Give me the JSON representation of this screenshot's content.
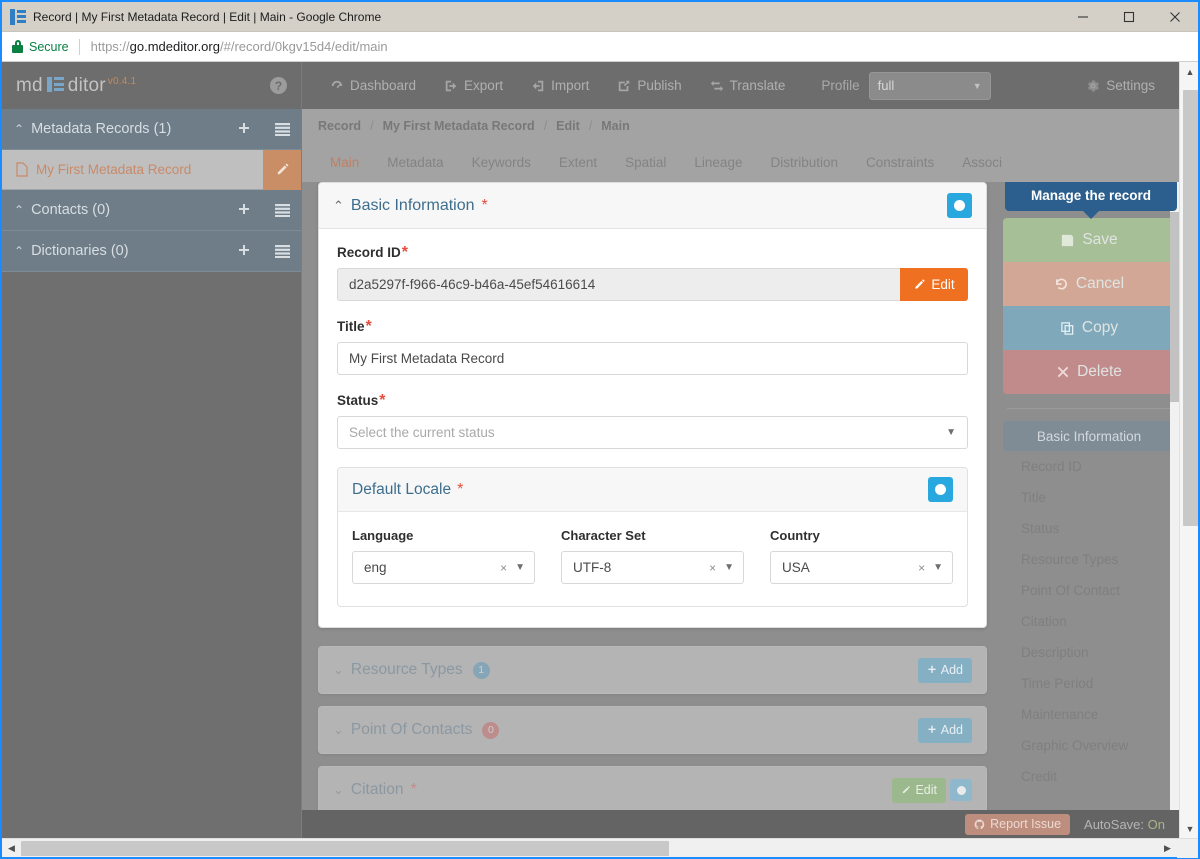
{
  "window": {
    "title": "Record | My First Metadata Record | Edit | Main - Google Chrome",
    "minimize": "—",
    "maximize": "□",
    "close": "✕"
  },
  "address_bar": {
    "security_label": "Secure",
    "url_prefix": "https://",
    "url_domain": "go.mdeditor.org",
    "url_path": "/#/record/0kgv15d4/edit/main",
    "lock_icon": "lock-icon"
  },
  "app_header": {
    "brand_pre": "md",
    "brand_post": "ditor",
    "version": "v0.4.1",
    "help_icon": "question-mark-icon",
    "menu_items": [
      {
        "label": "Dashboard",
        "icon": "dashboard-icon"
      },
      {
        "label": "Export",
        "icon": "export-icon"
      },
      {
        "label": "Import",
        "icon": "import-icon"
      },
      {
        "label": "Publish",
        "icon": "publish-icon"
      },
      {
        "label": "Translate",
        "icon": "translate-icon"
      }
    ],
    "profile_label": "Profile",
    "profile_value": "full",
    "settings_label": "Settings",
    "settings_icon": "gear-icon"
  },
  "sidebar": {
    "groups": [
      {
        "title": "Metadata Records (1)",
        "add_icon": "plus-icon",
        "list_icon": "list-icon"
      },
      {
        "title": "Contacts (0)",
        "add_icon": "plus-icon",
        "list_icon": "list-icon"
      },
      {
        "title": "Dictionaries (0)",
        "add_icon": "plus-icon",
        "list_icon": "list-icon"
      }
    ],
    "record_item": {
      "label": "My First Metadata Record",
      "file_icon": "file-icon",
      "edit_icon": "pencil-icon"
    }
  },
  "breadcrumb": {
    "items": [
      "Record",
      "My First Metadata Record",
      "Edit",
      "Main"
    ],
    "separator": "/"
  },
  "tabs": [
    {
      "label": "Main",
      "active": true
    },
    {
      "label": "Metadata",
      "active": false
    },
    {
      "label": "Keywords",
      "active": false
    },
    {
      "label": "Extent",
      "active": false
    },
    {
      "label": "Spatial",
      "active": false
    },
    {
      "label": "Lineage",
      "active": false
    },
    {
      "label": "Distribution",
      "active": false
    },
    {
      "label": "Constraints",
      "active": false
    },
    {
      "label": "Associ",
      "active": false
    }
  ],
  "basic_information": {
    "title": "Basic Information",
    "required_mark": "*",
    "collapse_icon": "chevron-up-icon",
    "toggle_icon": "radio-toggle-icon",
    "record_id": {
      "label": "Record ID",
      "required_mark": "*",
      "value": "d2a5297f-f966-46c9-b46a-45ef54616614",
      "edit_button": "Edit",
      "edit_icon": "pencil-icon"
    },
    "title_field": {
      "label": "Title",
      "required_mark": "*",
      "value": "My First Metadata Record"
    },
    "status": {
      "label": "Status",
      "required_mark": "*",
      "placeholder": "Select the current status",
      "caret_icon": "chevron-down-icon"
    },
    "default_locale": {
      "title": "Default Locale",
      "required_mark": "*",
      "toggle_icon": "radio-toggle-icon",
      "fields": [
        {
          "label": "Language",
          "value": "eng",
          "clear_icon": "x-icon",
          "caret_icon": "chevron-down-icon"
        },
        {
          "label": "Character Set",
          "value": "UTF-8",
          "clear_icon": "x-icon",
          "caret_icon": "chevron-down-icon"
        },
        {
          "label": "Country",
          "value": "USA",
          "clear_icon": "x-icon",
          "caret_icon": "chevron-down-icon"
        }
      ]
    }
  },
  "collapsed_sections": [
    {
      "title": "Resource Types",
      "count": "1",
      "count_color": "blue",
      "action": "Add",
      "action_type": "add",
      "required": false
    },
    {
      "title": "Point Of Contacts",
      "count": "0",
      "count_color": "red",
      "action": "Add",
      "action_type": "add",
      "required": false
    },
    {
      "title": "Citation",
      "count": "",
      "count_color": "",
      "action": "Edit",
      "action_type": "edit",
      "required": true
    }
  ],
  "record_panel": {
    "tooltip": "Manage the record",
    "buttons": [
      {
        "label": "Save",
        "icon": "floppy-disk-icon",
        "color": "#a7bf97"
      },
      {
        "label": "Cancel",
        "icon": "undo-icon",
        "color": "#d3a796"
      },
      {
        "label": "Copy",
        "icon": "copy-icon",
        "color": "#7fa9bb"
      },
      {
        "label": "Delete",
        "icon": "x-icon",
        "color": "#c28b8b"
      }
    ],
    "selected_nav": "Basic Information",
    "nav_items": [
      "Record ID",
      "Title",
      "Status",
      "Resource Types",
      "Point Of Contact",
      "Citation",
      "Description",
      "Time Period",
      "Maintenance",
      "Graphic Overview",
      "Credit"
    ]
  },
  "status_bar": {
    "report_label": "Report Issue",
    "report_icon": "github-icon",
    "autosave_label": "AutoSave:",
    "autosave_value": "On"
  },
  "colors": {
    "accent_orange": "#f07021",
    "accent_blue": "#29a8e0",
    "required_red": "#e74c3c",
    "tooltip_blue": "#2c5f8e",
    "link_blue": "#3e6e8e"
  }
}
